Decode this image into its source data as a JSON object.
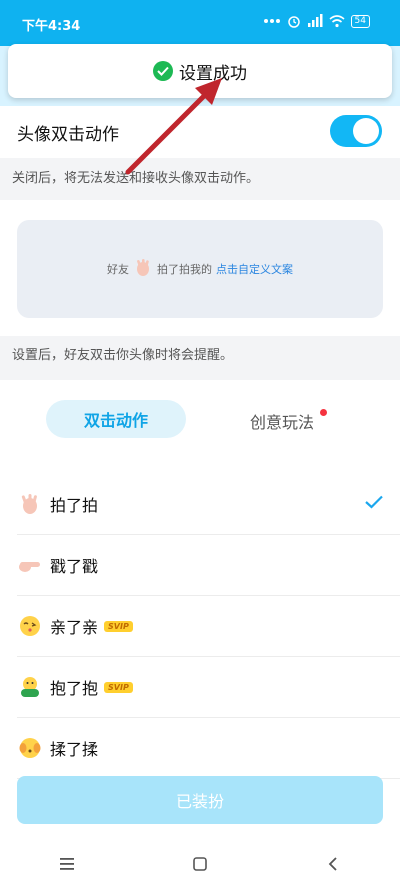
{
  "status_bar": {
    "time": "下午4:34",
    "battery": "54"
  },
  "toast": {
    "message": "设置成功"
  },
  "toggle_row": {
    "label": "头像双击动作",
    "enabled": true
  },
  "hints": {
    "toggle_hint": "关闭后，将无法发送和接收头像双击动作。",
    "remind_hint": "设置后，好友双击你头像时将会提醒。"
  },
  "preview": {
    "friend": "好友",
    "action_text": "拍了拍我的",
    "link_text": "点击自定义文案"
  },
  "tabs": [
    {
      "label": "双击动作",
      "active": true
    },
    {
      "label": "创意玩法",
      "active": false,
      "badge": true
    }
  ],
  "actions": [
    {
      "label": "拍了拍",
      "icon": "waving-hand-icon",
      "svip": false,
      "selected": true
    },
    {
      "label": "戳了戳",
      "icon": "pointing-hand-icon",
      "svip": false,
      "selected": false
    },
    {
      "label": "亲了亲",
      "icon": "kissing-face-icon",
      "svip": true,
      "selected": false
    },
    {
      "label": "抱了抱",
      "icon": "hugging-icon",
      "svip": true,
      "selected": false
    },
    {
      "label": "揉了揉",
      "icon": "rubbing-face-icon",
      "svip": false,
      "selected": false
    }
  ],
  "svip_label": "SVIP",
  "wear_button": {
    "label": "已装扮"
  },
  "colors": {
    "accent": "#0fb2f0",
    "toast_check": "#1db954",
    "arrow": "#c0262d",
    "badge": "#f5333f"
  }
}
